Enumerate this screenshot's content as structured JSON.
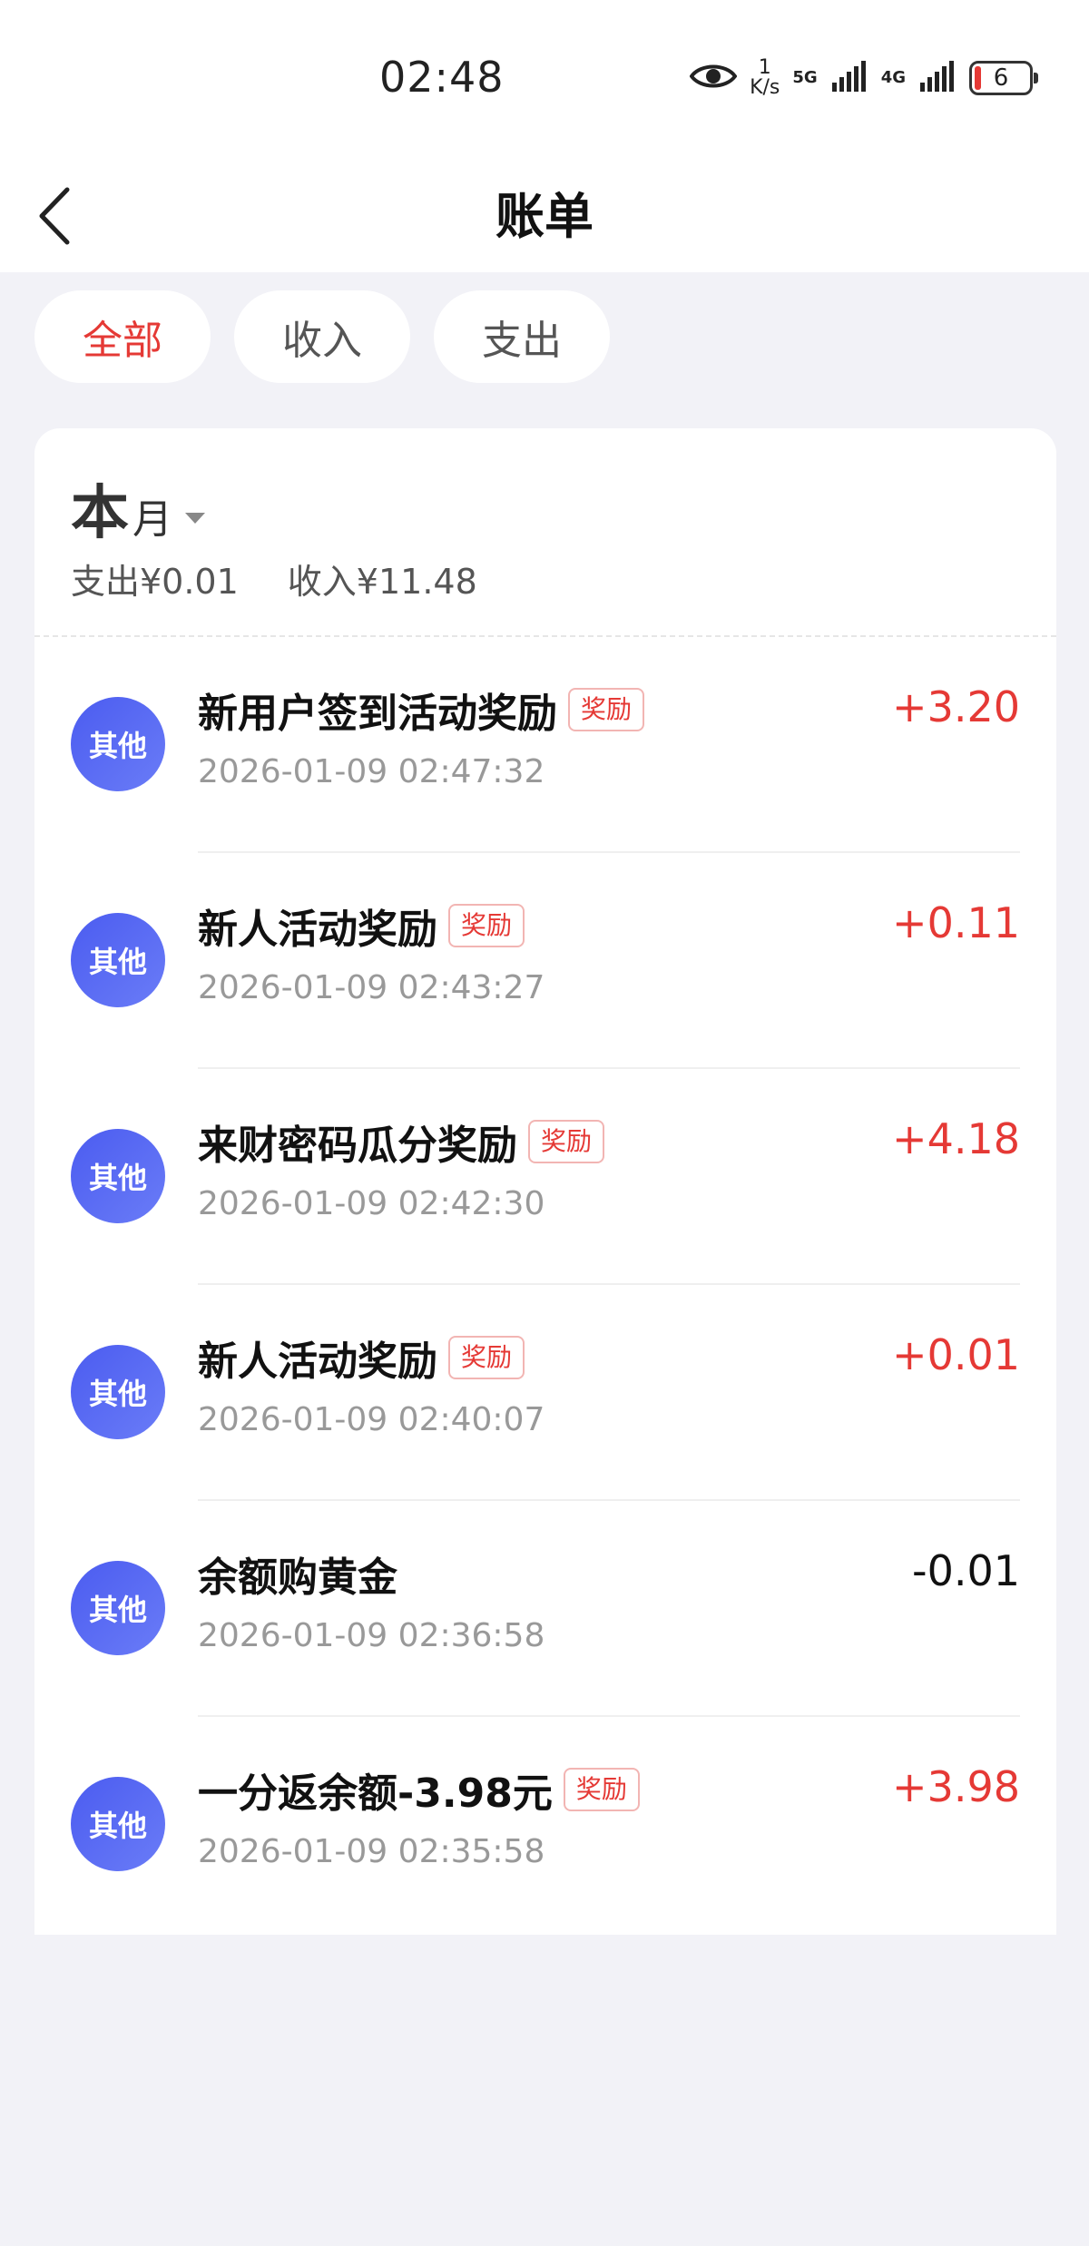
{
  "status_bar": {
    "time": "02:48",
    "net_speed_value": "1",
    "net_speed_unit": "K/s",
    "signal_1_label": "5G",
    "signal_2_label": "4G",
    "battery": "6"
  },
  "nav": {
    "title": "账单"
  },
  "tabs": [
    {
      "label": "全部",
      "active": true
    },
    {
      "label": "收入",
      "active": false
    },
    {
      "label": "支出",
      "active": false
    }
  ],
  "month": {
    "big": "本",
    "small": "月",
    "expense": "支出¥0.01",
    "income": "收入¥11.48"
  },
  "transactions": [
    {
      "category": "其他",
      "title": "新用户签到活动奖励",
      "tag": "奖励",
      "time": "2026-01-09 02:47:32",
      "amount": "+3.20",
      "type": "income"
    },
    {
      "category": "其他",
      "title": "新人活动奖励",
      "tag": "奖励",
      "time": "2026-01-09 02:43:27",
      "amount": "+0.11",
      "type": "income"
    },
    {
      "category": "其他",
      "title": "来财密码瓜分奖励",
      "tag": "奖励",
      "time": "2026-01-09 02:42:30",
      "amount": "+4.18",
      "type": "income"
    },
    {
      "category": "其他",
      "title": "新人活动奖励",
      "tag": "奖励",
      "time": "2026-01-09 02:40:07",
      "amount": "+0.01",
      "type": "income"
    },
    {
      "category": "其他",
      "title": "余额购黄金",
      "tag": "",
      "time": "2026-01-09 02:36:58",
      "amount": "-0.01",
      "type": "expense"
    },
    {
      "category": "其他",
      "title": "一分返余额-3.98元",
      "tag": "奖励",
      "time": "2026-01-09 02:35:58",
      "amount": "+3.98",
      "type": "income"
    }
  ],
  "colors": {
    "accent_red": "#e53935",
    "avatar_blue": "#4b5cf0",
    "page_bg": "#f2f2f7"
  }
}
